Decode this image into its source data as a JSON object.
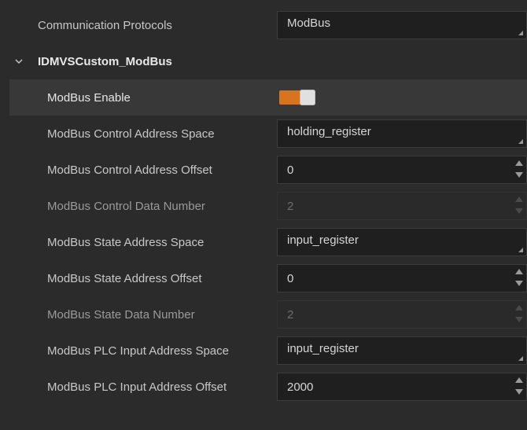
{
  "rows": {
    "protocol": {
      "label": "Communication Protocols",
      "value": "ModBus"
    },
    "group": {
      "label": "IDMVSCustom_ModBus"
    },
    "enable": {
      "label": "ModBus Enable"
    },
    "ctrl_space": {
      "label": "ModBus Control Address Space",
      "value": "holding_register"
    },
    "ctrl_offset": {
      "label": "ModBus Control Address Offset",
      "value": "0"
    },
    "ctrl_num": {
      "label": "ModBus Control Data Number",
      "value": "2"
    },
    "state_space": {
      "label": "ModBus State Address Space",
      "value": "input_register"
    },
    "state_offset": {
      "label": "ModBus State Address Offset",
      "value": "0"
    },
    "state_num": {
      "label": "ModBus State Data Number",
      "value": "2"
    },
    "plc_space": {
      "label": "ModBus PLC Input Address Space",
      "value": "input_register"
    },
    "plc_offset": {
      "label": "ModBus PLC Input Address Offset",
      "value": "2000"
    }
  },
  "colors": {
    "accent": "#d9741e",
    "background": "#2b2b2b",
    "field": "#1f1f1f"
  },
  "icons": {
    "group_toggle": "chevron-down-icon"
  }
}
